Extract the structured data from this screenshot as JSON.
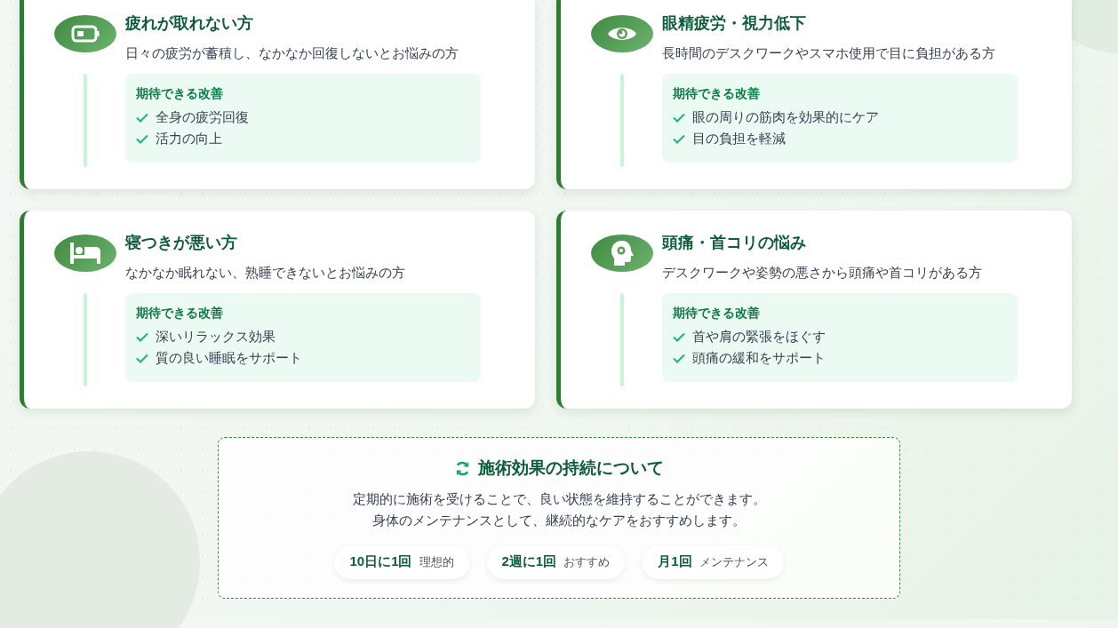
{
  "cards": [
    {
      "title": "疲れが取れない方",
      "description": "日々の疲労が蓄積し、なかなか回復しないとお悩みの方",
      "benefits_heading": "期待できる改善",
      "benefits": [
        "全身の疲労回復",
        "活力の向上"
      ]
    },
    {
      "title": "眼精疲労・視力低下",
      "description": "長時間のデスクワークやスマホ使用で目に負担がある方",
      "benefits_heading": "期待できる改善",
      "benefits": [
        "眼の周りの筋肉を効果的にケア",
        "目の負担を軽減"
      ]
    },
    {
      "title": "寝つきが悪い方",
      "description": "なかなか眠れない、熟睡できないとお悩みの方",
      "benefits_heading": "期待できる改善",
      "benefits": [
        "深いリラックス効果",
        "質の良い睡眠をサポート"
      ]
    },
    {
      "title": "頭痛・首コリの悩み",
      "description": "デスクワークや姿勢の悪さから頭痛や首コリがある方",
      "benefits_heading": "期待できる改善",
      "benefits": [
        "首や肩の緊張をほぐす",
        "頭痛の緩和をサポート"
      ]
    }
  ],
  "duration": {
    "title": "施術効果の持続について",
    "lines": [
      "定期的に施術を受けることで、良い状態を維持することができます。",
      "身体のメンテナンスとして、継続的なケアをおすすめします。"
    ],
    "frequencies": [
      {
        "value": "10日に1回",
        "label": "理想的"
      },
      {
        "value": "2週に1回",
        "label": "おすすめ"
      },
      {
        "value": "月1回",
        "label": "メンテナンス"
      }
    ]
  }
}
